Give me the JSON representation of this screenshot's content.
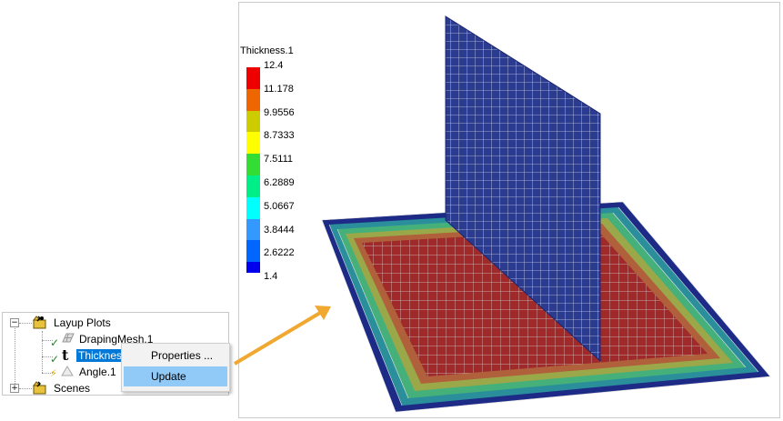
{
  "tree": {
    "items": [
      {
        "label": "Layup Plots",
        "icon": "layup-plots-icon"
      },
      {
        "label": "DrapingMesh.1",
        "icon": "mesh-icon"
      },
      {
        "label": "Thicknes",
        "icon": "thickness-t-icon",
        "selected": true
      },
      {
        "label": "Angle.1",
        "icon": "angle-icon"
      },
      {
        "label": "Scenes",
        "icon": "scenes-icon"
      }
    ]
  },
  "context_menu": {
    "items": [
      {
        "label": "Properties ..."
      },
      {
        "label": "Update",
        "highlighted": true
      }
    ]
  },
  "legend": {
    "title": "Thickness.1",
    "values": [
      "12.4",
      "11.178",
      "9.9556",
      "8.7333",
      "7.5111",
      "6.2889",
      "5.0667",
      "3.8444",
      "2.6222",
      "1.4"
    ],
    "colors": [
      "#ee0000",
      "#ee6600",
      "#cccc00",
      "#ffff00",
      "#33dd33",
      "#00ee88",
      "#00ffff",
      "#3399ff",
      "#0066ff",
      "#0000ee"
    ]
  },
  "colors": {
    "selection": "#0078d7",
    "menu_highlight": "#91c9f7",
    "arrow": "#f0a830",
    "web_mesh": "#2b3b8f",
    "ply_center": "#a02a2a"
  }
}
